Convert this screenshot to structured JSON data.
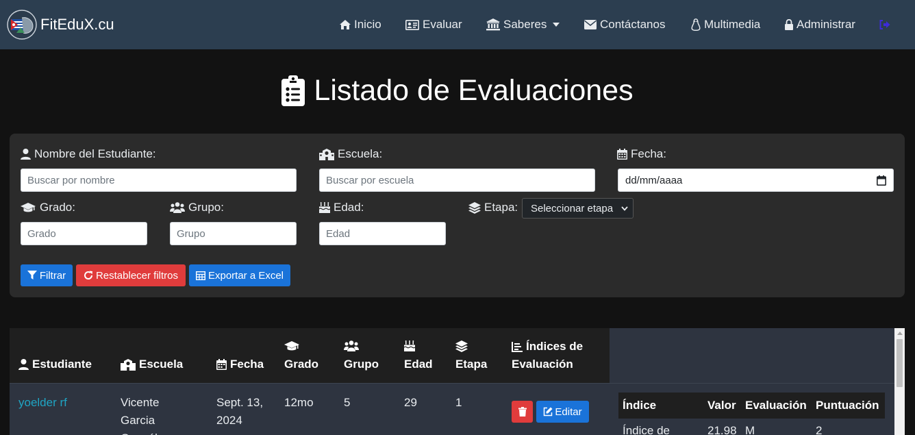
{
  "navbar": {
    "brand": "FitEduX.cu",
    "items": [
      {
        "label": "Inicio",
        "icon": "home-icon"
      },
      {
        "label": "Evaluar",
        "icon": "id-card-icon"
      },
      {
        "label": "Saberes",
        "icon": "institution-icon"
      },
      {
        "label": "Contáctanos",
        "icon": "envelope-icon"
      },
      {
        "label": "Multimedia",
        "icon": "linux-icon"
      },
      {
        "label": "Administrar",
        "icon": "lock-icon"
      }
    ],
    "logout_icon": "sign-out-icon"
  },
  "page": {
    "title": "Listado de Evaluaciones"
  },
  "filters": {
    "nombre_label": "Nombre del Estudiante:",
    "nombre_placeholder": "Buscar por nombre",
    "escuela_label": "Escuela:",
    "escuela_placeholder": "Buscar por escuela",
    "fecha_label": "Fecha:",
    "fecha_value": "dd/mm/aaaa",
    "grado_label": "Grado:",
    "grado_placeholder": "Grado",
    "grupo_label": "Grupo:",
    "grupo_placeholder": "Grupo",
    "edad_label": "Edad:",
    "edad_placeholder": "Edad",
    "etapa_label": "Etapa:",
    "etapa_selected": "Seleccionar etapa",
    "btn_filtrar": "Filtrar",
    "btn_restablecer": "Restablecer filtros",
    "btn_exportar": "Exportar a Excel"
  },
  "table": {
    "headers": {
      "estudiante": "Estudiante",
      "escuela": "Escuela",
      "fecha": "Fecha",
      "grado": "Grado",
      "grupo": "Grupo",
      "edad": "Edad",
      "etapa": "Etapa",
      "indices_line1": "Índices de",
      "indices_line2": "Evaluación"
    },
    "rows": [
      {
        "estudiante": "yoelder rf",
        "escuela_line1": "Vicente",
        "escuela_line2": "Garcia",
        "escuela_line3": "González",
        "fecha_line1": "Sept. 13,",
        "fecha_line2": "2024",
        "grado": "12mo",
        "grupo": "5",
        "edad": "29",
        "etapa": "1",
        "edit_label": "Editar"
      }
    ],
    "indices": {
      "headers": {
        "indice": "Índice",
        "valor": "Valor",
        "evaluacion": "Evaluación",
        "puntuacion": "Puntuación"
      },
      "rows": [
        {
          "indice": "Índice de",
          "valor": "21.98",
          "evaluacion": "M",
          "puntuacion": "2"
        }
      ]
    }
  },
  "colors": {
    "navbar": "#2c3e50",
    "background": "#121212",
    "primary": "#1a73d9",
    "danger": "#e03c3c",
    "link": "#1fa5c4"
  }
}
